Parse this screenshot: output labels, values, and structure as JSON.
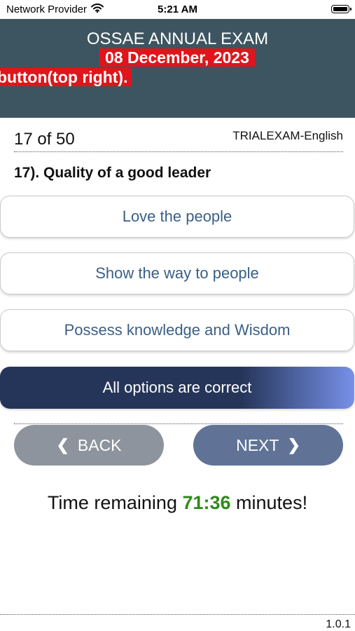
{
  "status_bar": {
    "carrier": "Network Provider",
    "time": "5:21 AM"
  },
  "header": {
    "title": "OSSAE ANNUAL EXAM",
    "date": "08 December, 2023",
    "marquee": "button(top right)."
  },
  "question": {
    "counter": "17 of 50",
    "exam_name": "TRIALEXAM-English",
    "text": "17). Quality of a good leader",
    "options": [
      "Love the people",
      "Show the way to people",
      "Possess knowledge and Wisdom",
      "All options are correct"
    ],
    "selected_option": "All options are correct"
  },
  "nav": {
    "back_label": "BACK",
    "next_label": "NEXT"
  },
  "timer": {
    "prefix": "Time remaining ",
    "value": "71:36",
    "suffix": " minutes!"
  },
  "version": "1.0.1",
  "colors": {
    "header_bg": "#3d5560",
    "highlight_red": "#e0141c",
    "option_text": "#3a5f86",
    "selected_gradient_start": "#253559",
    "selected_gradient_end": "#7791e9",
    "back_button": "#8e949d",
    "next_button": "#607397",
    "timer_green": "#2f8a1a"
  },
  "icons": {
    "wifi": "wifi-icon",
    "battery": "battery-icon",
    "back": "chevron-left-icon",
    "next": "chevron-right-icon"
  }
}
